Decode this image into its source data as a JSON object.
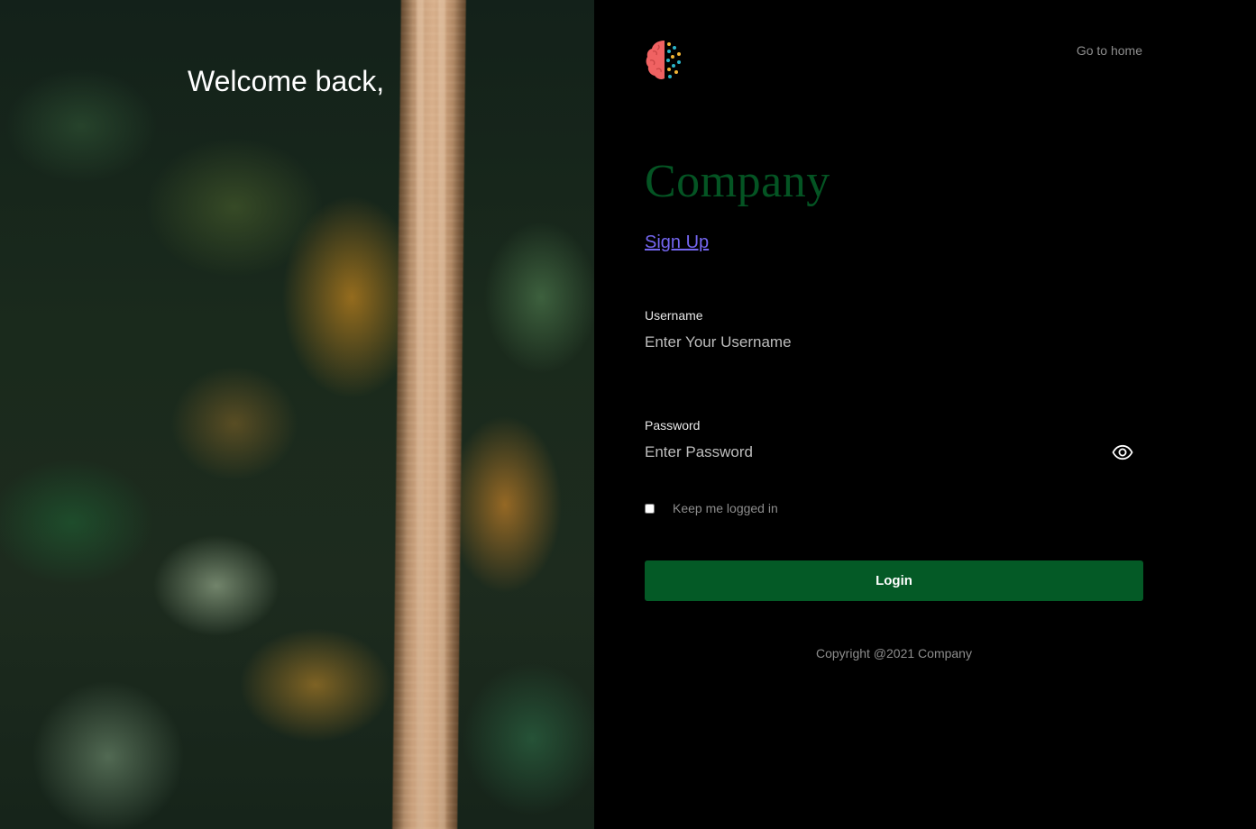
{
  "hero": {
    "title": "Welcome back,"
  },
  "header": {
    "logo_icon": "brain-icon",
    "go_home_label": "Go to home"
  },
  "brand": {
    "name": "Company",
    "color": "#045423"
  },
  "signup": {
    "label": "Sign Up",
    "color": "#7466f0"
  },
  "form": {
    "username": {
      "label": "Username",
      "placeholder": "Enter Your Username",
      "value": ""
    },
    "password": {
      "label": "Password",
      "placeholder": "Enter Password",
      "value": "",
      "toggle_icon": "eye-icon"
    },
    "remember": {
      "label": "Keep me logged in",
      "checked": false
    },
    "login_label": "Login",
    "login_color": "#045a26"
  },
  "footer": {
    "copyright": "Copyright @2021 Company"
  }
}
